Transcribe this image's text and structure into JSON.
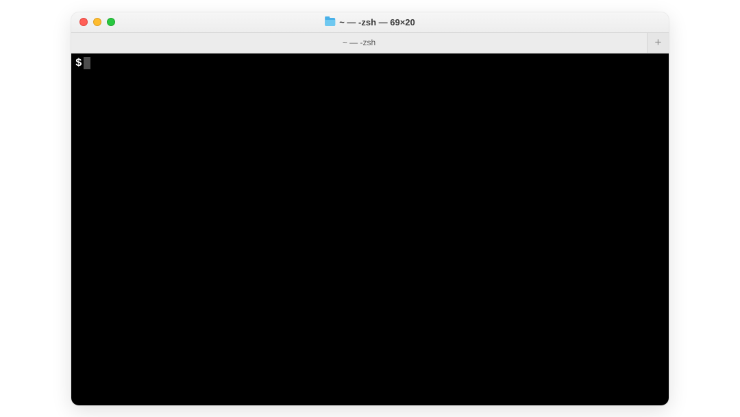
{
  "window": {
    "title": "~ — -zsh — 69×20"
  },
  "tabs": {
    "active_label": "~ — -zsh"
  },
  "terminal": {
    "prompt": "$"
  }
}
